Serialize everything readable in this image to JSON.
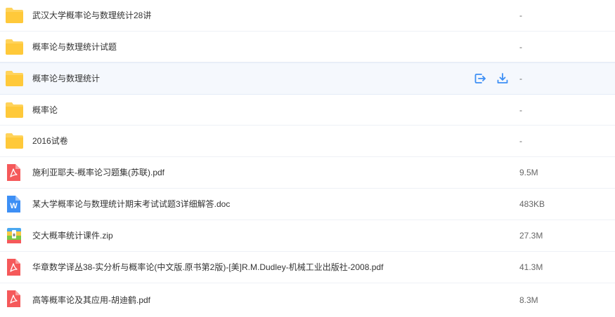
{
  "files": [
    {
      "name": "武汉大学概率论与数理统计28讲",
      "type": "folder",
      "size": "-"
    },
    {
      "name": "概率论与数理统计试题",
      "type": "folder",
      "size": "-"
    },
    {
      "name": "概率论与数理统计",
      "type": "folder",
      "size": "-",
      "hovered": true
    },
    {
      "name": "概率论",
      "type": "folder",
      "size": "-"
    },
    {
      "name": "2016试卷",
      "type": "folder",
      "size": "-"
    },
    {
      "name": "施利亚耶夫-概率论习题集(苏联).pdf",
      "type": "pdf",
      "size": "9.5M"
    },
    {
      "name": "某大学概率论与数理统计期末考试试题3详细解答.doc",
      "type": "doc",
      "size": "483KB"
    },
    {
      "name": "交大概率统计课件.zip",
      "type": "zip",
      "size": "27.3M"
    },
    {
      "name": "华章数学译丛38-实分析与概率论(中文版.原书第2版)-[美]R.M.Dudley-机械工业出版社-2008.pdf",
      "type": "pdf",
      "size": "41.3M"
    },
    {
      "name": "高等概率论及其应用-胡迪鹤.pdf",
      "type": "pdf",
      "size": "8.3M"
    }
  ],
  "icons": {
    "folder": "folder-icon",
    "pdf": "pdf-file-icon",
    "doc": "word-doc-icon",
    "zip": "zip-archive-icon",
    "share": "share-icon",
    "download": "download-icon"
  },
  "colors": {
    "folder": "#ffd35b",
    "pdf": "#f5595a",
    "doc": "#3d8ff5",
    "action": "#3d8ff5",
    "hover_bg": "#f5f8fd"
  }
}
